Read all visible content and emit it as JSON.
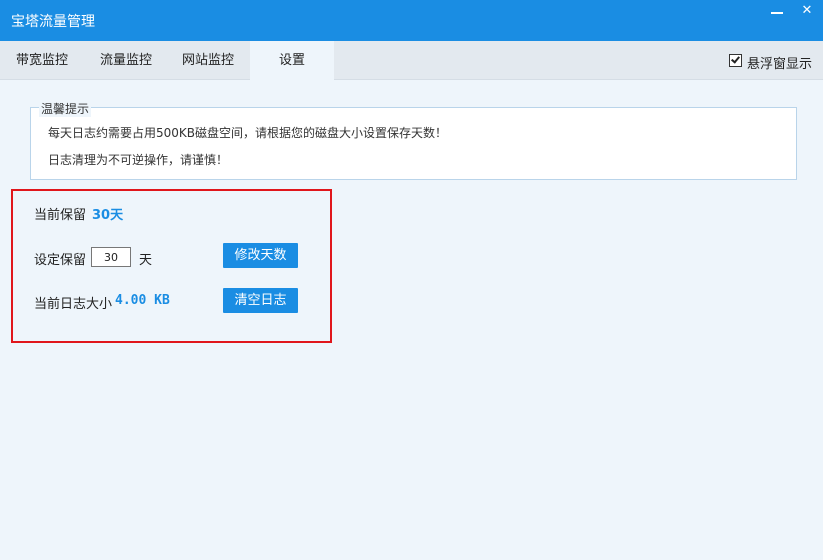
{
  "window": {
    "title": "宝塔流量管理",
    "minimize_glyph": "—",
    "close_glyph": "✕"
  },
  "tabs": [
    {
      "label": "带宽监控",
      "active": false
    },
    {
      "label": "流量监控",
      "active": false
    },
    {
      "label": "网站监控",
      "active": false
    },
    {
      "label": "设置",
      "active": true
    }
  ],
  "float_window": {
    "label": "悬浮窗显示",
    "checked": true
  },
  "notice": {
    "title": "温馨提示",
    "lines": [
      "每天日志约需要占用500KB磁盘空间，请根据您的磁盘大小设置保存天数！",
      "日志清理为不可逆操作，请谨慎！"
    ]
  },
  "settings": {
    "current_retention_label": "当前保留",
    "current_retention_value": "30天",
    "set_retention_label": "设定保留",
    "set_retention_input": "30",
    "set_retention_unit": "天",
    "modify_button": "修改天数",
    "log_size_label": "当前日志大小",
    "log_size_value": "4.00 KB",
    "clear_button": "清空日志"
  },
  "colors": {
    "accent": "#1a8de3",
    "highlight_border": "#e0161b",
    "background": "#eef5fb"
  }
}
